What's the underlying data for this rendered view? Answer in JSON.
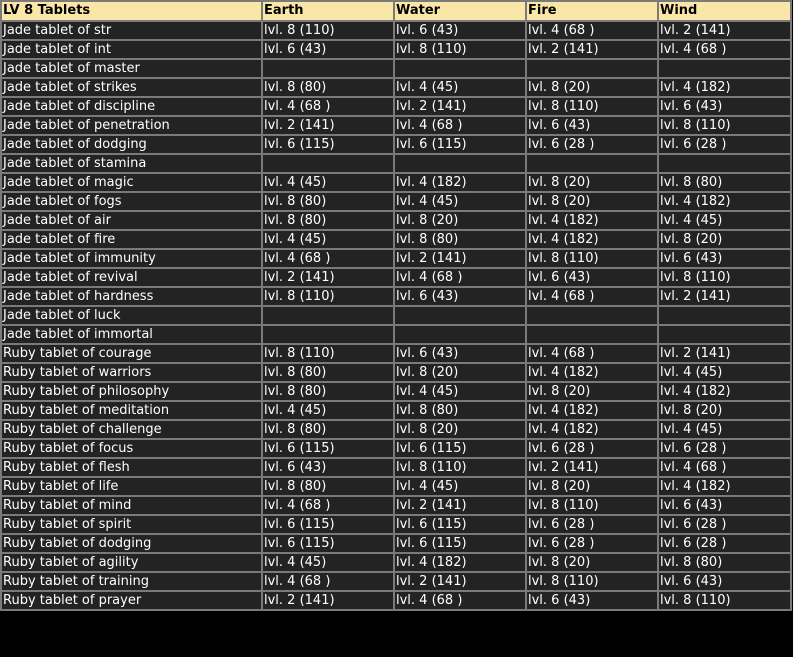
{
  "table": {
    "headers": [
      "LV 8 Tablets",
      "Earth",
      "Water",
      "Fire",
      "Wind"
    ],
    "rows": [
      [
        "Jade tablet of str",
        "lvl. 8 (110)",
        "lvl. 6 (43)",
        "lvl. 4 (68 )",
        "lvl. 2 (141)"
      ],
      [
        "Jade tablet of int",
        "lvl. 6 (43)",
        "lvl. 8 (110)",
        "lvl. 2 (141)",
        "lvl. 4 (68 )"
      ],
      [
        "Jade tablet of master",
        "",
        "",
        "",
        ""
      ],
      [
        "Jade tablet of strikes",
        "lvl. 8 (80)",
        "lvl. 4 (45)",
        "lvl. 8 (20)",
        "lvl. 4 (182)"
      ],
      [
        "Jade tablet of discipline",
        "lvl. 4 (68 )",
        "lvl. 2 (141)",
        "lvl. 8 (110)",
        "lvl. 6 (43)"
      ],
      [
        "Jade tablet of penetration",
        "lvl. 2 (141)",
        "lvl. 4 (68 )",
        "lvl. 6 (43)",
        "lvl. 8 (110)"
      ],
      [
        "Jade tablet of dodging",
        "lvl. 6 (115)",
        "lvl. 6 (115)",
        "lvl. 6 (28 )",
        "lvl. 6 (28 )"
      ],
      [
        "Jade tablet of stamina",
        "",
        "",
        "",
        ""
      ],
      [
        "Jade tablet of magic",
        "lvl. 4 (45)",
        "lvl. 4 (182)",
        "lvl. 8 (20)",
        "lvl. 8 (80)"
      ],
      [
        "Jade tablet of fogs",
        "lvl. 8 (80)",
        "lvl. 4 (45)",
        "lvl. 8 (20)",
        "lvl. 4 (182)"
      ],
      [
        "Jade tablet of air",
        "lvl. 8 (80)",
        "lvl. 8 (20)",
        "lvl. 4 (182)",
        "lvl. 4 (45)"
      ],
      [
        "Jade tablet of fire",
        "lvl. 4 (45)",
        "lvl. 8 (80)",
        "lvl. 4 (182)",
        "lvl. 8 (20)"
      ],
      [
        "Jade tablet of immunity",
        "lvl. 4 (68 )",
        "lvl. 2 (141)",
        "lvl. 8 (110)",
        "lvl. 6 (43)"
      ],
      [
        "Jade tablet of revival",
        "lvl. 2 (141)",
        "lvl. 4 (68 )",
        "lvl. 6 (43)",
        "lvl. 8 (110)"
      ],
      [
        "Jade tablet of hardness",
        "lvl. 8 (110)",
        "lvl. 6 (43)",
        "lvl. 4 (68 )",
        "lvl. 2 (141)"
      ],
      [
        "Jade tablet of luck",
        "",
        "",
        "",
        ""
      ],
      [
        "Jade tablet of immortal",
        "",
        "",
        "",
        ""
      ],
      [
        "Ruby tablet of courage",
        "lvl. 8 (110)",
        "lvl. 6 (43)",
        "lvl. 4 (68 )",
        "lvl. 2 (141)"
      ],
      [
        "Ruby tablet of warriors",
        "lvl. 8 (80)",
        "lvl. 8 (20)",
        "lvl. 4 (182)",
        "lvl. 4 (45)"
      ],
      [
        "Ruby tablet of philosophy",
        "lvl. 8 (80)",
        "lvl. 4 (45)",
        "lvl. 8 (20)",
        "lvl. 4 (182)"
      ],
      [
        "Ruby tablet of meditation",
        "lvl. 4 (45)",
        "lvl. 8 (80)",
        "lvl. 4 (182)",
        "lvl. 8 (20)"
      ],
      [
        "Ruby tablet of challenge",
        "lvl. 8 (80)",
        "lvl. 8 (20)",
        "lvl. 4 (182)",
        "lvl. 4 (45)"
      ],
      [
        "Ruby tablet of focus",
        "lvl. 6 (115)",
        "lvl. 6 (115)",
        "lvl. 6 (28 )",
        "lvl. 6 (28 )"
      ],
      [
        "Ruby tablet of flesh",
        "lvl. 6 (43)",
        "lvl. 8 (110)",
        "lvl. 2 (141)",
        "lvl. 4 (68 )"
      ],
      [
        "Ruby tablet of life",
        "lvl. 8 (80)",
        "lvl. 4 (45)",
        "lvl. 8 (20)",
        "lvl. 4 (182)"
      ],
      [
        "Ruby tablet of mind",
        "lvl. 4 (68 )",
        "lvl. 2 (141)",
        "lvl. 8 (110)",
        "lvl. 6 (43)"
      ],
      [
        "Ruby tablet of spirit",
        "lvl. 6 (115)",
        "lvl. 6 (115)",
        "lvl. 6 (28 )",
        "lvl. 6 (28 )"
      ],
      [
        "Ruby tablet of dodging",
        "lvl. 6 (115)",
        "lvl. 6 (115)",
        "lvl. 6 (28 )",
        "lvl. 6 (28 )"
      ],
      [
        "Ruby tablet of agility",
        "lvl. 4 (45)",
        "lvl. 4 (182)",
        "lvl. 8 (20)",
        "lvl. 8 (80)"
      ],
      [
        "Ruby tablet of training",
        "lvl. 4 (68 )",
        "lvl. 2 (141)",
        "lvl. 8 (110)",
        "lvl. 6 (43)"
      ],
      [
        "Ruby tablet of prayer",
        "lvl. 2 (141)",
        "lvl. 4 (68 )",
        "lvl. 6 (43)",
        "lvl. 8 (110)"
      ]
    ]
  },
  "colors": {
    "header_bg": "#fae7a7",
    "header_text": "#000000",
    "cell_bg": "#232323",
    "cell_text": "#ffffff",
    "border": "#7a7a7a"
  }
}
